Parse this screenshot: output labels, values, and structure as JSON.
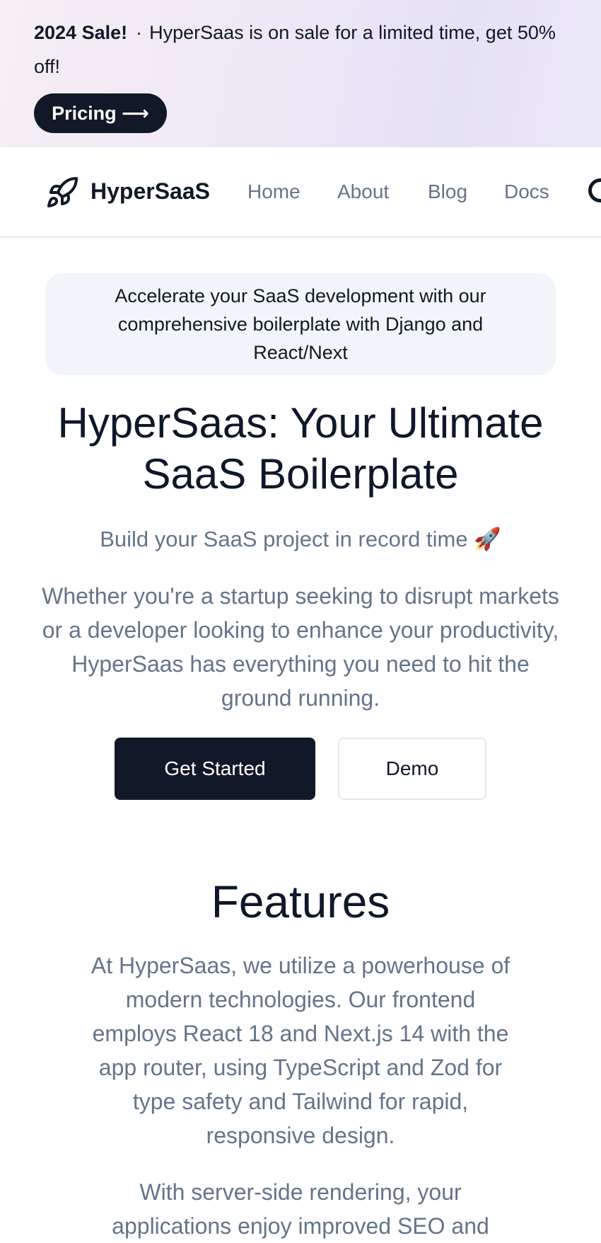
{
  "banner": {
    "highlight": "2024 Sale!",
    "separator": "·",
    "message": "HyperSaas is on sale for a limited time, get 50% off!",
    "button_label": "Pricing ⟶"
  },
  "nav": {
    "brand": "HyperSaaS",
    "logo_icon": "rocket-icon",
    "links": [
      "Home",
      "About",
      "Blog",
      "Docs"
    ],
    "edge_icon": "github-icon"
  },
  "hero": {
    "tagline": "Accelerate your SaaS development with our comprehensive boilerplate with Django and React/Next",
    "title": "HyperSaas: Your Ultimate SaaS Boilerplate",
    "subtitle": "Build your SaaS project in record time 🚀",
    "description": "Whether you're a startup seeking to disrupt markets or a developer looking to enhance your productivity, HyperSaas has everything you need to hit the ground running.",
    "primary_button": "Get Started",
    "secondary_button": "Demo"
  },
  "features": {
    "title": "Features",
    "paragraph1": "At HyperSaas, we utilize a powerhouse of modern technologies. Our frontend employs React 18 and Next.js 14 with the app router, using TypeScript and Zod for type safety and Tailwind for rapid, responsive design.",
    "paragraph2": "With server-side rendering, your applications enjoy improved SEO and"
  },
  "colors": {
    "primary": "#111827",
    "muted_text": "#64748b",
    "tagline_bg": "#f1f5f9",
    "banner_bg": "#eee8f6"
  }
}
